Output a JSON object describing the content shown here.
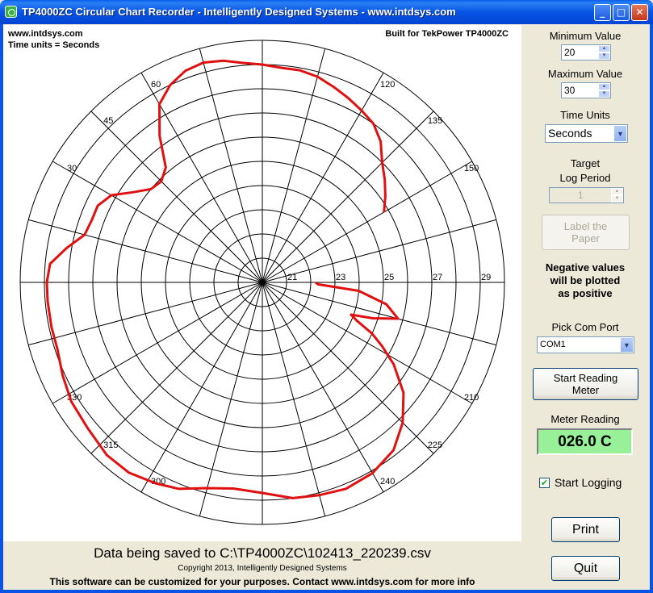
{
  "window": {
    "title": "TP4000ZC Circular Chart Recorder - Intelligently Designed Systems - www.intdsys.com",
    "minimize_glyph": "_",
    "maximize_glyph": "□",
    "close_glyph": "✕"
  },
  "chart": {
    "top_left_line1": "www.intdsys.com",
    "top_left_line2": "Time units = Seconds",
    "top_right": "Built for TekPower TP4000ZC",
    "trace_color": "#E01010",
    "ring_labels": [
      "21",
      "23",
      "25",
      "27",
      "29"
    ],
    "spoke_labels": [
      "300",
      "315",
      "330",
      "30",
      "45",
      "60",
      "120",
      "135",
      "150",
      "210",
      "225",
      "240"
    ]
  },
  "chart_data": {
    "type": "line",
    "projection": "polar",
    "r_range": [
      20,
      30
    ],
    "theta_units": "Seconds",
    "theta_ticks": [
      30,
      45,
      60,
      120,
      135,
      150,
      210,
      225,
      240,
      300,
      315,
      330
    ],
    "r_ticks": [
      21,
      23,
      25,
      27,
      29
    ],
    "grid": true,
    "series": [
      {
        "theta": [
          0,
          2,
          5,
          10,
          15,
          18,
          20,
          22,
          25,
          28,
          32,
          38,
          45,
          52,
          60,
          68,
          75,
          82,
          90,
          98,
          105,
          112,
          118,
          125,
          132,
          140,
          148,
          155,
          162,
          168,
          175,
          180,
          185,
          190,
          195,
          200,
          205,
          210,
          215,
          220,
          225,
          230,
          235,
          240,
          245,
          250,
          255,
          260,
          265,
          270,
          275,
          280,
          285,
          290,
          295,
          300,
          305,
          310,
          315,
          320,
          325,
          330
        ],
        "r": [
          22.2,
          22.3,
          24.0,
          25.2,
          25.8,
          24.8,
          23.9,
          24.2,
          25.0,
          25.6,
          26.4,
          27.4,
          28.2,
          28.8,
          29.1,
          29.2,
          29.1,
          29.0,
          28.7,
          28.6,
          28.8,
          29.2,
          29.4,
          29.6,
          29.6,
          29.4,
          29.3,
          29.1,
          28.9,
          28.9,
          28.9,
          28.9,
          28.8,
          28.2,
          27.6,
          27.5,
          27.5,
          27.2,
          26.5,
          26.0,
          25.9,
          26.2,
          27.4,
          28.5,
          29.0,
          29.3,
          29.4,
          29.3,
          29.1,
          29.0,
          28.9,
          28.9,
          28.8,
          28.6,
          28.4,
          28.2,
          28.0,
          27.6,
          27.0,
          26.6,
          26.2,
          25.8
        ]
      }
    ]
  },
  "sidebar": {
    "min_label": "Minimum Value",
    "min_value": "20",
    "max_label": "Maximum Value",
    "max_value": "30",
    "time_units_label": "Time Units",
    "time_units_value": "Seconds",
    "target_label_1": "Target",
    "target_label_2": "Log Period",
    "target_value": "1",
    "label_paper_1": "Label the",
    "label_paper_2": "Paper",
    "neg_note_1": "Negative values",
    "neg_note_2": "will be plotted",
    "neg_note_3": "as positive",
    "com_label": "Pick Com Port",
    "com_value": "COM1",
    "start_btn_1": "Start Reading",
    "start_btn_2": "Meter",
    "meter_label": "Meter Reading",
    "meter_value": "026.0  C",
    "logging_label": "Start Logging",
    "logging_checked": true,
    "print_label": "Print",
    "quit_label": "Quit"
  },
  "footer": {
    "saving_text": "Data being saved to C:\\TP4000ZC\\102413_220239.csv",
    "copyright": "Copyright 2013, Intelligently Designed Systems",
    "custom_note": "This software can be customized for your purposes.  Contact www.intdsys.com for more info"
  }
}
